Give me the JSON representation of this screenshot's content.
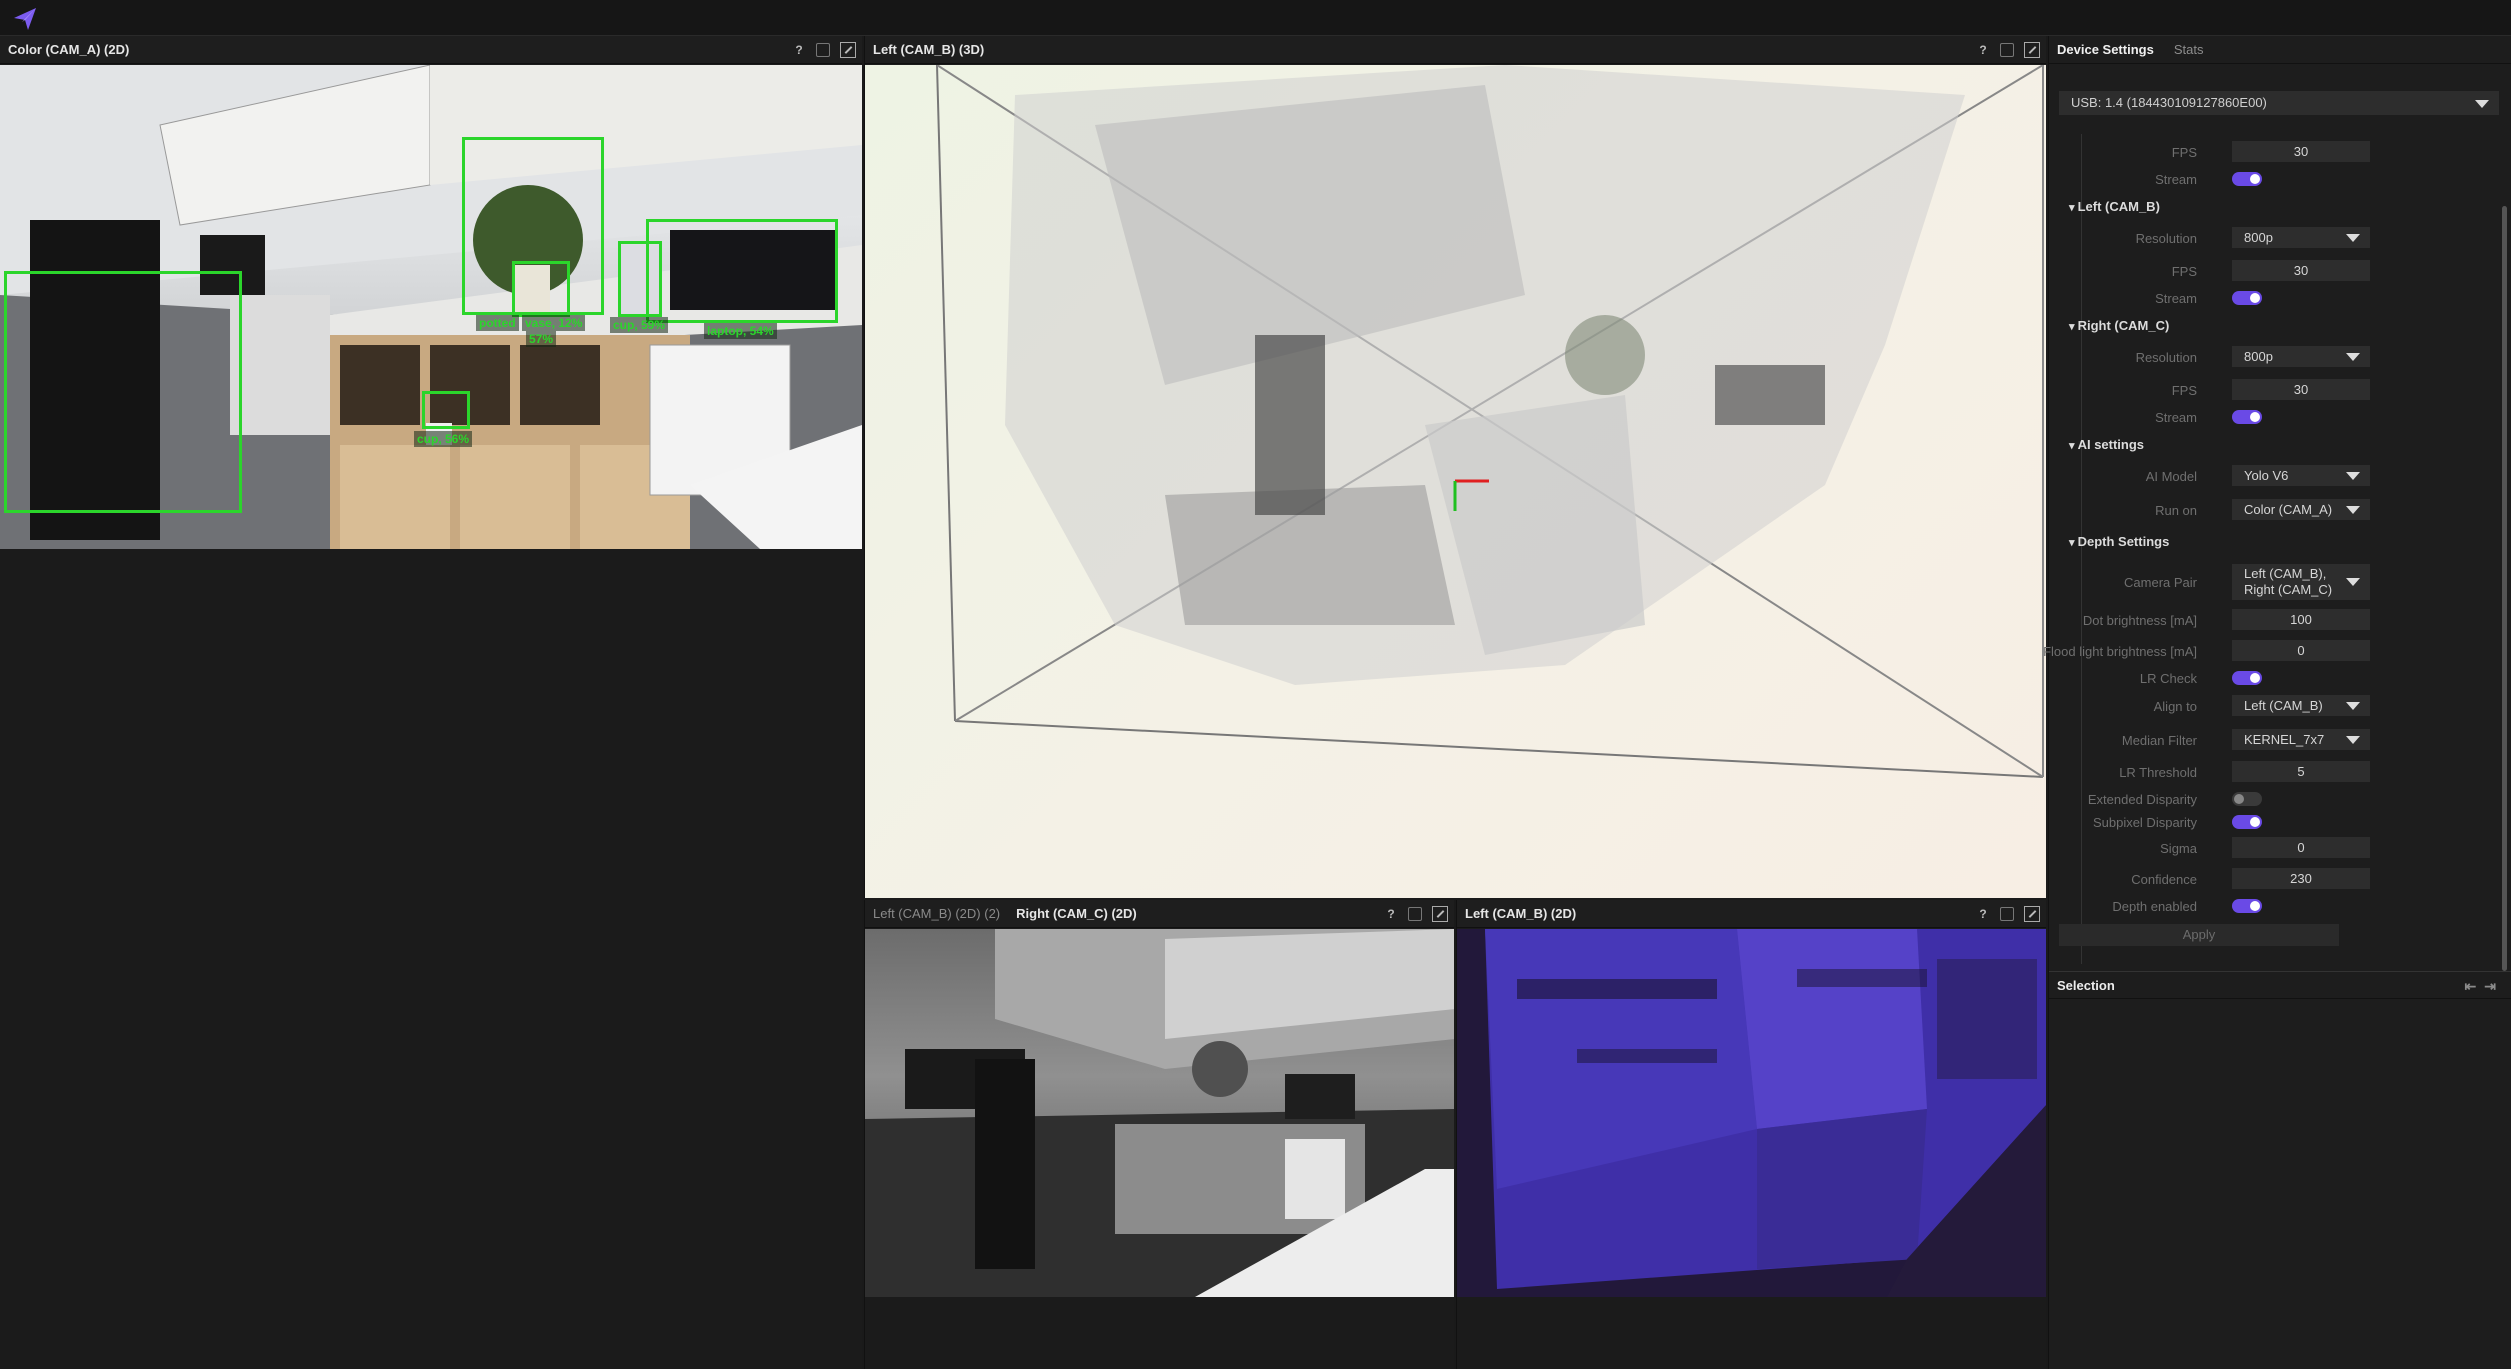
{
  "app": {
    "logo": "luxonis-logo-icon"
  },
  "panels": {
    "color": {
      "title": "Color (CAM_A) (2D)"
    },
    "left3d": {
      "title": "Left (CAM_B) (3D)"
    },
    "bottom_left": {
      "tab_inactive": "Left (CAM_B) (2D) (2)",
      "tab_active": "Right (CAM_C) (2D)"
    },
    "bottom_right": {
      "title": "Left (CAM_B) (2D)"
    },
    "help_label": "?"
  },
  "detections": [
    {
      "label": "potted",
      "color": "#2bd52b"
    },
    {
      "label": "vase, 12%",
      "color": "#2bd52b"
    },
    {
      "label": "57%",
      "color": "#2bd52b"
    },
    {
      "label": "cup, 59%",
      "color": "#2bd52b"
    },
    {
      "label": "laptop, 54%",
      "color": "#2bd52b"
    },
    {
      "label": "cup, 56%",
      "color": "#2bd52b"
    }
  ],
  "sidebar": {
    "tabs": [
      "Device Settings",
      "Stats"
    ],
    "device": "USB: 1.4 (184430109127860E00)",
    "color_cam": {
      "fps_label": "FPS",
      "fps": "30",
      "stream_label": "Stream",
      "stream": true
    },
    "left_cam": {
      "title": "Left (CAM_B)",
      "resolution_label": "Resolution",
      "resolution": "800p",
      "fps_label": "FPS",
      "fps": "30",
      "stream_label": "Stream",
      "stream": true
    },
    "right_cam": {
      "title": "Right (CAM_C)",
      "resolution_label": "Resolution",
      "resolution": "800p",
      "fps_label": "FPS",
      "fps": "30",
      "stream_label": "Stream",
      "stream": true
    },
    "ai": {
      "title": "AI settings",
      "model_label": "AI Model",
      "model": "Yolo V6",
      "run_on_label": "Run on",
      "run_on": "Color (CAM_A)"
    },
    "depth": {
      "title": "Depth Settings",
      "camera_pair_label": "Camera Pair",
      "camera_pair_line1": "Left (CAM_B),",
      "camera_pair_line2": "Right (CAM_C)",
      "dot_label": "Dot brightness [mA]",
      "dot": "100",
      "flood_label": "Flood light brightness [mA]",
      "flood": "0",
      "lr_check_label": "LR Check",
      "lr_check": true,
      "align_label": "Align to",
      "align": "Left (CAM_B)",
      "median_label": "Median Filter",
      "median": "KERNEL_7x7",
      "lr_threshold_label": "LR Threshold",
      "lr_threshold": "5",
      "extended_label": "Extended Disparity",
      "extended": false,
      "subpixel_label": "Subpixel Disparity",
      "subpixel": true,
      "sigma_label": "Sigma",
      "sigma": "0",
      "confidence_label": "Confidence",
      "confidence": "230",
      "depth_enabled_label": "Depth enabled",
      "depth_enabled": true
    },
    "apply_label": "Apply",
    "selection_title": "Selection",
    "accent_color": "#6a4ae6"
  }
}
